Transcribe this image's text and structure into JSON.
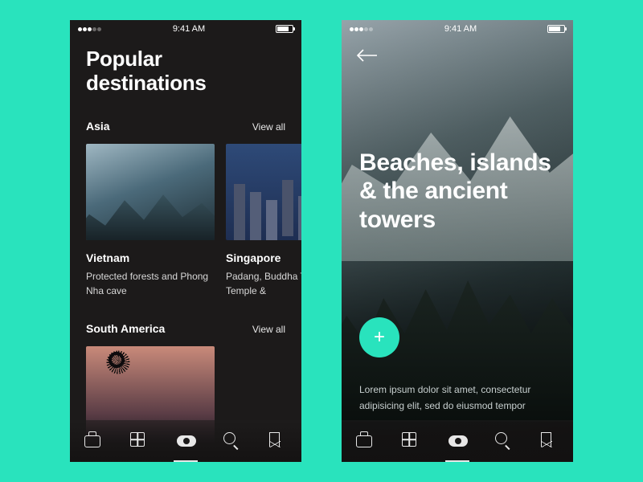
{
  "status": {
    "time": "9:41 AM"
  },
  "screen1": {
    "title": "Popular destinations",
    "sections": [
      {
        "label": "Asia",
        "viewall": "View all",
        "cards": [
          {
            "title": "Vietnam",
            "sub": "Protected forests and Phong Nha cave"
          },
          {
            "title": "Singapore",
            "sub": "Padang, Buddha Tooth Temple &"
          }
        ]
      },
      {
        "label": "South America",
        "viewall": "View all"
      }
    ]
  },
  "screen2": {
    "hero": "Beaches, islands & the ancient towers",
    "lorem": "Lorem ipsum dolor sit amet, consectetur adipisicing elit, sed do eiusmod tempor"
  },
  "tabs": [
    "briefcase",
    "grid",
    "explore",
    "search",
    "bookmark"
  ]
}
